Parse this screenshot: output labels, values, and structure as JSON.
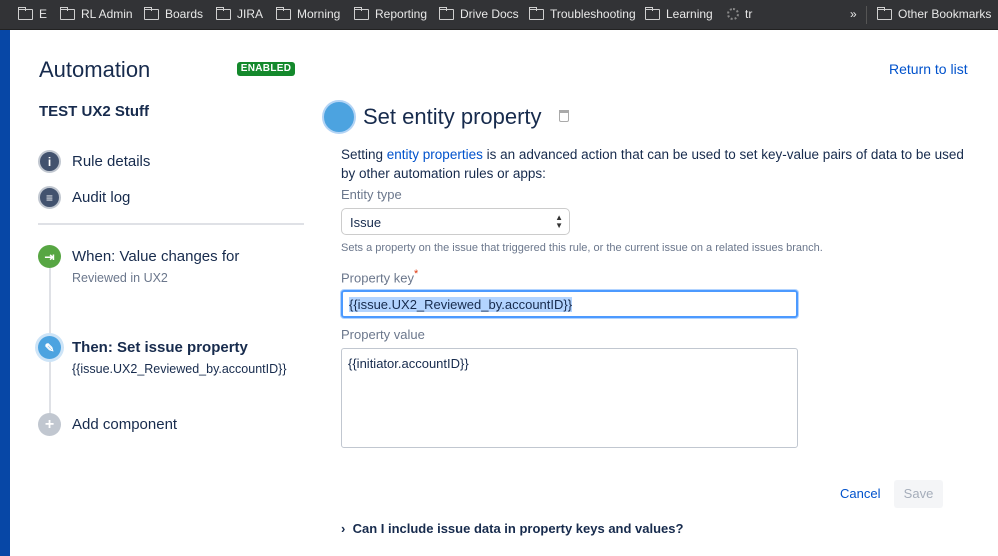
{
  "bookmarks": [
    "E",
    "RL Admin",
    "Boards",
    "JIRA",
    "Morning",
    "Reporting",
    "Drive Docs",
    "Troubleshooting",
    "Learning",
    "tr"
  ],
  "bookmarks_overflow": "»",
  "other_bookmarks": "Other Bookmarks",
  "header": {
    "title": "Automation",
    "status": "ENABLED",
    "return_link": "Return to list"
  },
  "sidebar": {
    "project": "TEST UX2 Stuff",
    "items": [
      {
        "label": "Rule details"
      },
      {
        "label": "Audit log"
      }
    ],
    "steps": [
      {
        "label": "When: Value changes for",
        "sub": "Reviewed in UX2"
      },
      {
        "label": "Then: Set issue property",
        "sub": "{{issue.UX2_Reviewed_by.accountID}}"
      },
      {
        "label": "Add component"
      }
    ]
  },
  "main": {
    "title": "Set entity property",
    "desc_pre": "Setting ",
    "desc_link": "entity properties",
    "desc_post": " is an advanced action that can be used to set key-value pairs of data to be used by other automation rules or apps:",
    "entity_type_label": "Entity type",
    "entity_type_value": "Issue",
    "entity_help": "Sets a property on the issue that triggered this rule, or the current issue on a related issues branch.",
    "property_key_label": "Property key",
    "required_mark": "*",
    "property_key_value": "{{issue.UX2_Reviewed_by.accountID}}",
    "property_value_label": "Property value",
    "property_value": "{{initiator.accountID}}",
    "cancel": "Cancel",
    "save": "Save",
    "faq": "Can I include issue data in property keys and values?",
    "faq_chevron": "›"
  }
}
